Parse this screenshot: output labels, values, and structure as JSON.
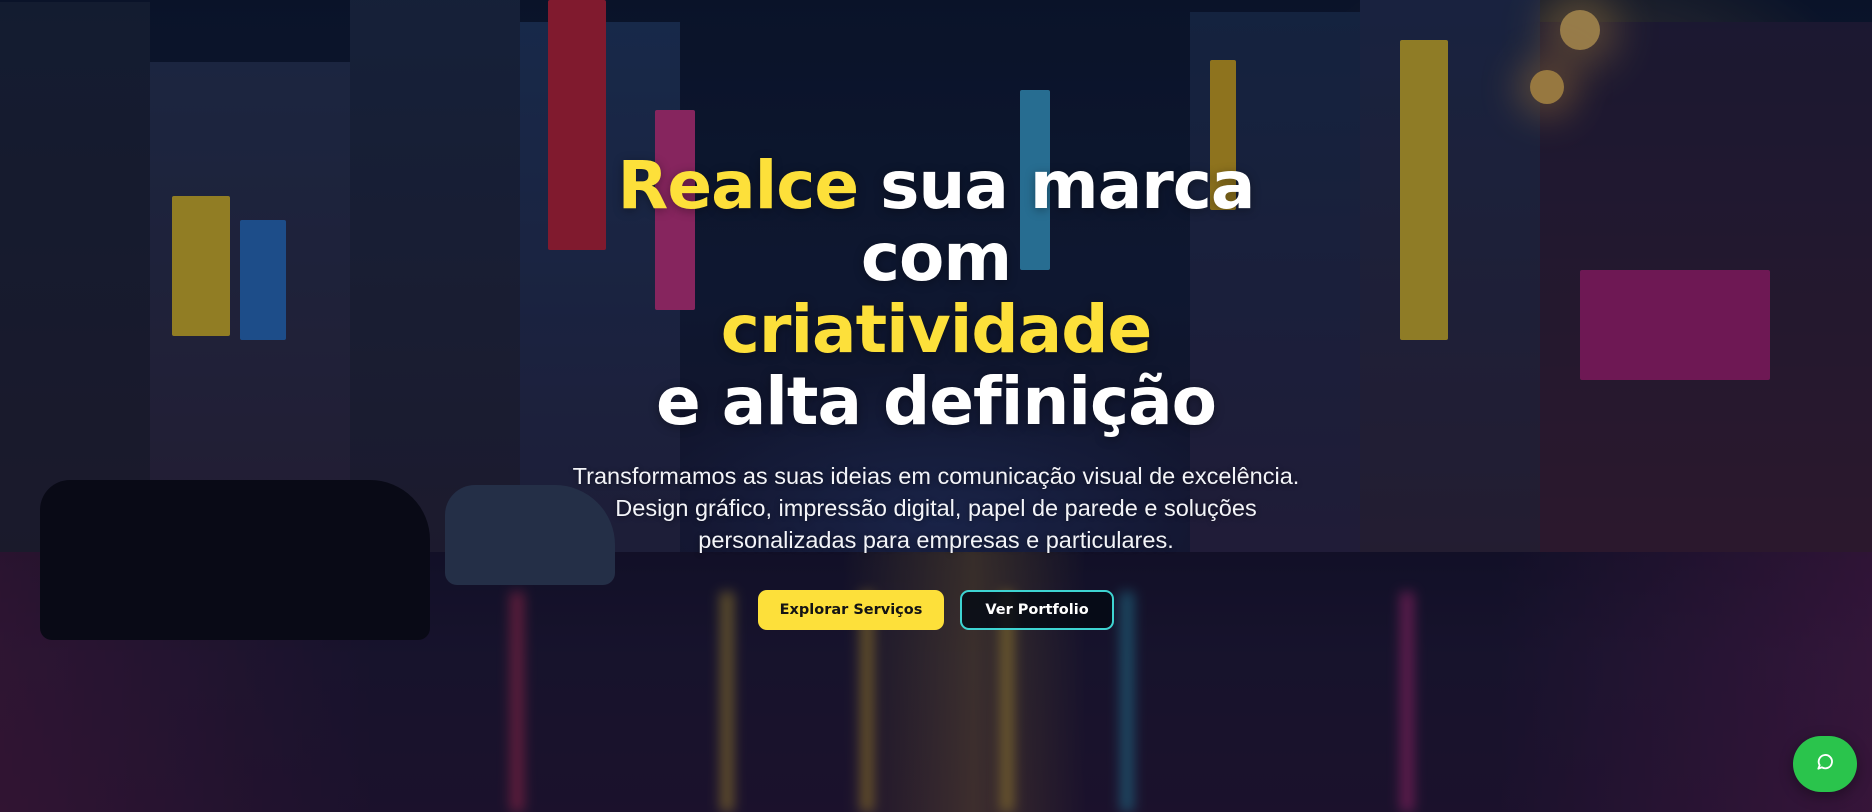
{
  "hero": {
    "headline": {
      "line1_accent": "Realce",
      "line1_rest": " sua marca",
      "line2": "com",
      "line3_accent": "criatividade",
      "line4": "e alta definição"
    },
    "subtitle": "Transformamos as suas ideias em comunicação visual de excelência. Design gráfico, impressão digital, papel de parede e soluções personalizadas para empresas e particulares.",
    "buttons": {
      "primary_label": "Explorar Serviços",
      "secondary_label": "Ver Portfolio"
    }
  },
  "chat_widget": {
    "icon": "chat-bubble-icon"
  },
  "colors": {
    "accent": "#fde03a",
    "outline": "#3ed4d2",
    "chat": "#2ac44c"
  }
}
